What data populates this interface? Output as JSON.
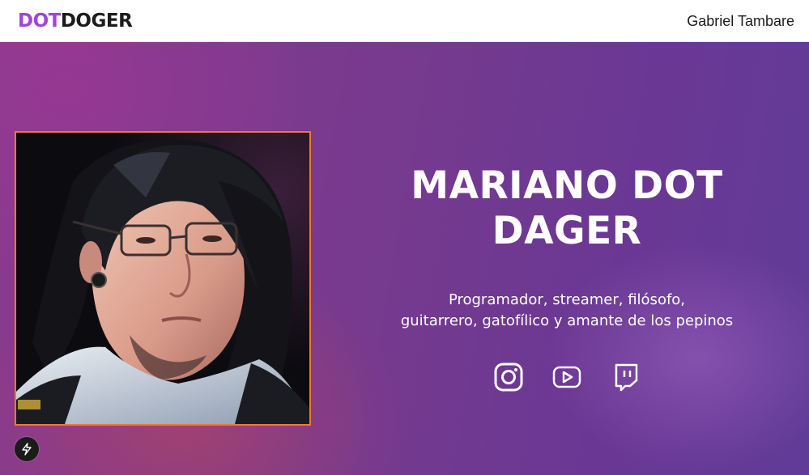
{
  "header": {
    "logo_dot": "DOT",
    "logo_doger": "DOGER",
    "user_name": "Gabriel Tambare"
  },
  "hero": {
    "title_line1": "MARIANO DOT",
    "title_line2": "DAGER",
    "tagline_line1": "Programador, streamer, filósofo,",
    "tagline_line2": "guitarrero, gatofílico y amante de los pepinos",
    "portrait_alt": "Retrato ilustrado",
    "socials": [
      {
        "name": "instagram",
        "icon": "instagram-icon"
      },
      {
        "name": "youtube",
        "icon": "youtube-icon"
      },
      {
        "name": "twitch",
        "icon": "twitch-icon"
      }
    ]
  },
  "colors": {
    "logo_accent": "#a344d6",
    "portrait_border": "#f07a2c",
    "hero_gradient_start": "#8a3a8e",
    "hero_gradient_end": "#613b98"
  }
}
